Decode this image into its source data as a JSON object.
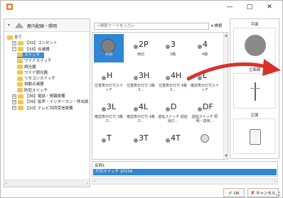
{
  "window": {
    "controls": {
      "minimize": "—",
      "maximize": "□",
      "close": "✕"
    }
  },
  "left": {
    "category": "屋内配線・照明",
    "tree": [
      {
        "label": "全て",
        "indent": 0,
        "exp": "",
        "expanded": false,
        "selected": false,
        "folder": true
      },
      {
        "label": "【32】コンセント",
        "indent": 1,
        "exp": "+",
        "selected": false,
        "folder": true
      },
      {
        "label": "【33】点滅器",
        "indent": 1,
        "exp": "−",
        "selected": false,
        "folder": true
      },
      {
        "label": "スイッチ",
        "indent": 2,
        "exp": "",
        "selected": true,
        "folder": true
      },
      {
        "label": "ワイドスイッチ",
        "indent": 2,
        "exp": "",
        "selected": false,
        "folder": true
      },
      {
        "label": "調光器",
        "indent": 2,
        "exp": "",
        "selected": false,
        "folder": true
      },
      {
        "label": "ワイド調光器",
        "indent": 2,
        "exp": "",
        "selected": false,
        "folder": true
      },
      {
        "label": "リモコンスイッチ",
        "indent": 2,
        "exp": "",
        "selected": false,
        "folder": true
      },
      {
        "label": "自動点滅器",
        "indent": 2,
        "exp": "",
        "selected": false,
        "folder": true
      },
      {
        "label": "防犯スイッチ",
        "indent": 2,
        "exp": "",
        "selected": false,
        "folder": true
      },
      {
        "label": "【36】電話・情報設備",
        "indent": 1,
        "exp": "+",
        "selected": false,
        "folder": true
      },
      {
        "label": "【39】拡声・インターホン・呼出設",
        "indent": 1,
        "exp": "+",
        "selected": false,
        "folder": true
      },
      {
        "label": "【10】テレビ共同受信設備",
        "indent": 1,
        "exp": "+",
        "selected": false,
        "folder": true
      }
    ]
  },
  "search": {
    "placeholder": "<検索ワードを入力>",
    "button": "▾ 検索"
  },
  "grid": {
    "cells": [
      {
        "symbol": "",
        "label": "片切",
        "shape": "bigcircle",
        "selected": true
      },
      {
        "symbol": "2P",
        "label": "両切",
        "shape": "dot",
        "selected": false
      },
      {
        "symbol": "3",
        "label": "3路",
        "shape": "dot",
        "selected": false
      },
      {
        "symbol": "4",
        "label": "4路",
        "shape": "dot",
        "selected": false
      },
      {
        "symbol": "H",
        "label": "位置表示灯付スイッチ",
        "shape": "dot",
        "selected": false
      },
      {
        "symbol": "3H",
        "label": "位置表示灯付 3路ス...",
        "shape": "dot",
        "selected": false
      },
      {
        "symbol": "4H",
        "label": "位置表示灯付 4路ス...",
        "shape": "dot",
        "selected": false
      },
      {
        "symbol": "L",
        "label": "確認表示灯付スイッチ",
        "shape": "dot",
        "selected": false
      },
      {
        "symbol": "3L",
        "label": "確認表示灯付 3路ス...",
        "shape": "dot",
        "selected": false
      },
      {
        "symbol": "4L",
        "label": "確認表示灯付 4路ス...",
        "shape": "dot",
        "selected": false
      },
      {
        "symbol": "D",
        "label": "遅延スイッチ 遅延消灯...",
        "shape": "dot",
        "selected": false
      },
      {
        "symbol": "DF",
        "label": "遅延スイッチ 照明・換気...",
        "shape": "dot",
        "selected": false
      },
      {
        "symbol": "T",
        "label": "",
        "shape": "dot",
        "selected": false
      },
      {
        "symbol": "3T",
        "label": "",
        "shape": "dot",
        "selected": false
      },
      {
        "symbol": "4T",
        "label": "",
        "shape": "dot",
        "selected": false
      },
      {
        "symbol": "",
        "label": "",
        "shape": "plaincircle",
        "selected": false
      }
    ]
  },
  "name": {
    "label": "名称1",
    "value": "片切スイッチ 1P15A"
  },
  "preview": {
    "plan_title": "平面",
    "side_title": "立面図",
    "front_title": "正面"
  },
  "buttons": {
    "ok": "OK",
    "cancel": "キャンセル"
  },
  "colors": {
    "selection": "#2f86d4",
    "arrow": "#d6322c",
    "folder": "#f1c453"
  }
}
